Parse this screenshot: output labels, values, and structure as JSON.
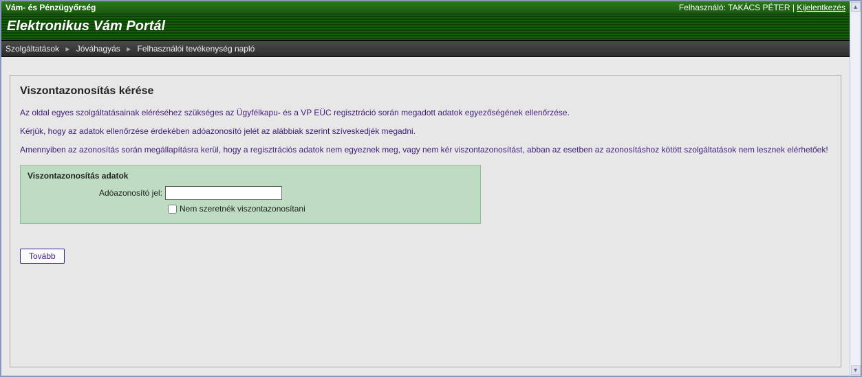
{
  "topbar": {
    "org": "Vám- és Pénzügyőrség",
    "user_label": "Felhasználó:",
    "user_name": "TAKÁCS PÉTER",
    "sep": " | ",
    "logout": "Kijelentkezés"
  },
  "title": "Elektronikus Vám Portál",
  "breadcrumb": {
    "items": [
      "Szolgáltatások",
      "Jóváhagyás",
      "Felhasználói tevékenység napló"
    ],
    "sep": "▸"
  },
  "page": {
    "heading": "Viszontazonosítás kérése",
    "p1": "Az oldal egyes szolgáltatásainak eléréséhez szükséges az Ügyfélkapu- és a VP EÜC regisztráció során megadott adatok egyezőségének ellenőrzése.",
    "p2": "Kérjük, hogy az adatok ellenőrzése érdekében adóazonosító jelét az alábbiak szerint szíveskedjék megadni.",
    "p3": "Amennyiben az azonosítás során megállapításra kerül, hogy a regisztrációs adatok nem egyeznek meg, vagy nem kér viszontazonosítást, abban az esetben az azonosításhoz kötött szolgáltatások nem lesznek elérhetőek!"
  },
  "form": {
    "legend": "Viszontazonosítás adatok",
    "field_label": "Adóazonosító jel:",
    "field_value": "",
    "checkbox_label": "Nem szeretnék viszontazonosítani",
    "checkbox_checked": false,
    "submit": "Tovább"
  }
}
